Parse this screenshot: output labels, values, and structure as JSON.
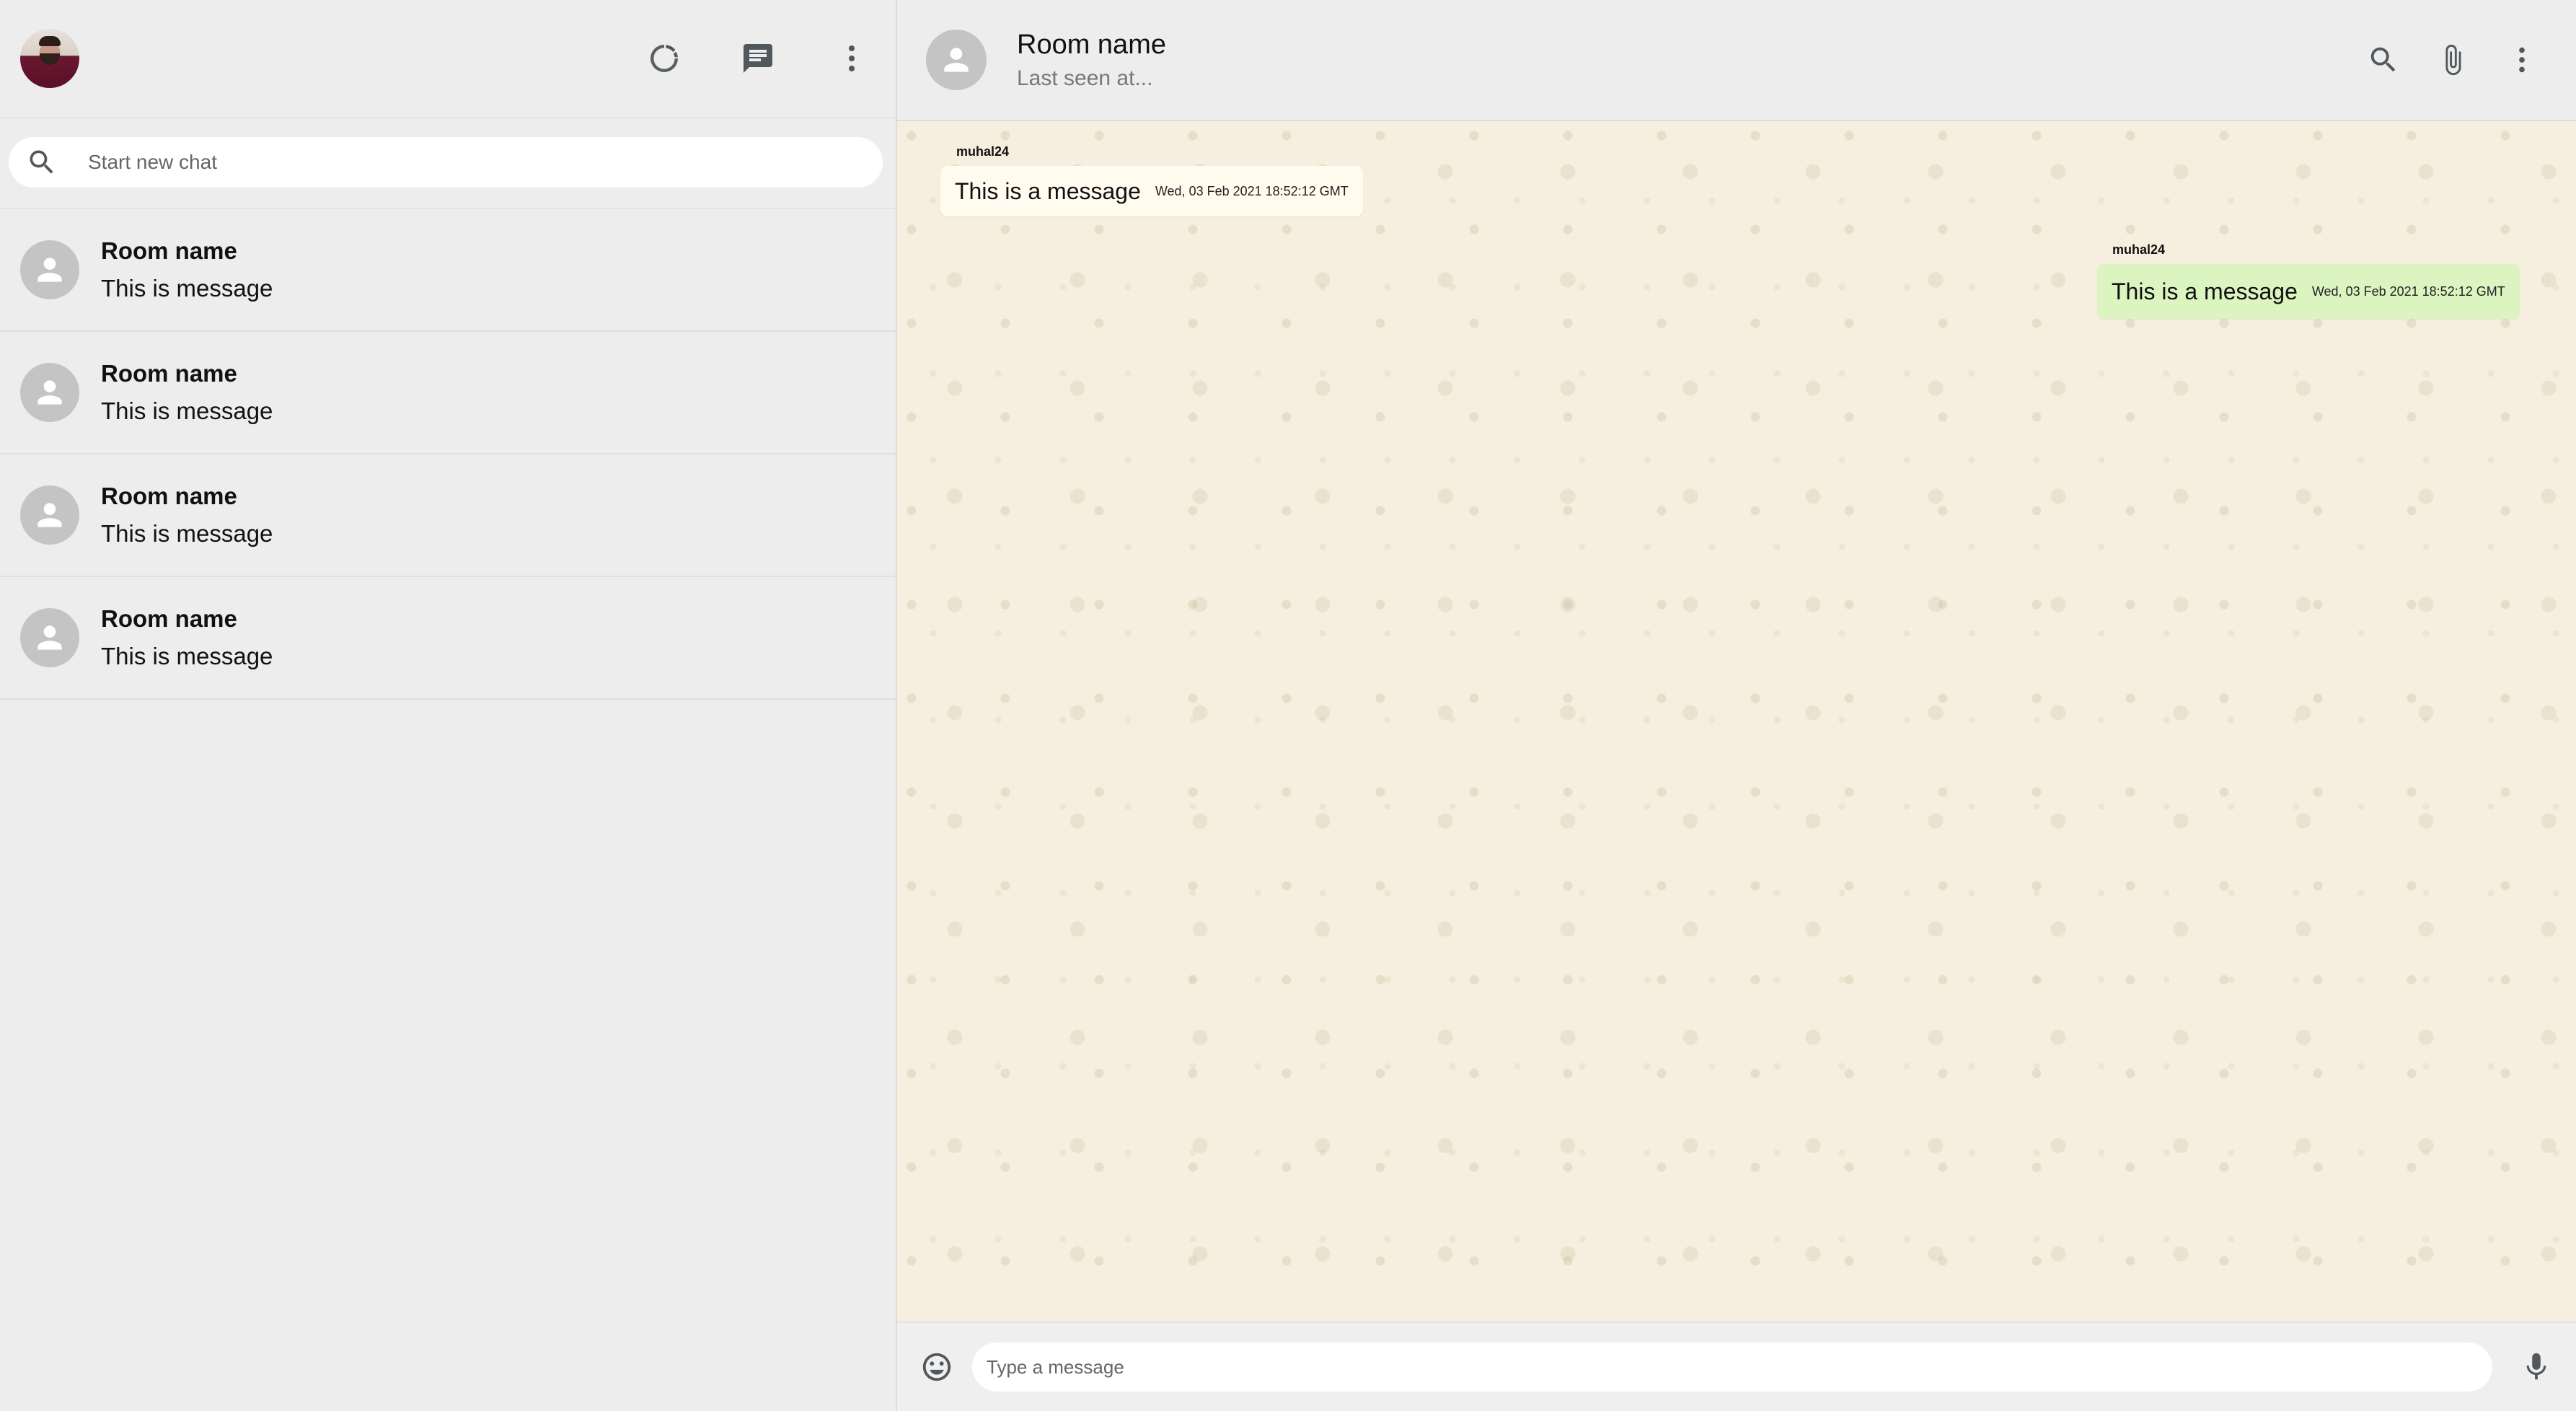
{
  "sidebar": {
    "header": {
      "icons": [
        "status-icon",
        "new-chat-icon",
        "menu-icon"
      ]
    },
    "search": {
      "placeholder": "Start new chat"
    },
    "chats": [
      {
        "name": "Room name",
        "last_message": "This is message"
      },
      {
        "name": "Room name",
        "last_message": "This is message"
      },
      {
        "name": "Room name",
        "last_message": "This is message"
      },
      {
        "name": "Room name",
        "last_message": "This is message"
      }
    ]
  },
  "chat": {
    "header": {
      "title": "Room name",
      "subtitle": "Last seen at...",
      "icons": [
        "search-icon",
        "attach-icon",
        "menu-icon"
      ]
    },
    "messages": [
      {
        "sender": "muhal24",
        "text": "This is a message",
        "timestamp": "Wed, 03 Feb 2021 18:52:12 GMT",
        "direction": "received"
      },
      {
        "sender": "muhal24",
        "text": "This is a message",
        "timestamp": "Wed, 03 Feb 2021 18:52:12 GMT",
        "direction": "sent"
      }
    ],
    "footer": {
      "placeholder": "Type a message",
      "icons": [
        "emoji-icon",
        "microphone-icon"
      ]
    }
  },
  "colors": {
    "sidebar_bg": "#ededed",
    "chat_bg": "#f6efdf",
    "sent_bubble": "#dcf4c0",
    "received_bubble": "#fffbef",
    "icon": "#51585c"
  }
}
